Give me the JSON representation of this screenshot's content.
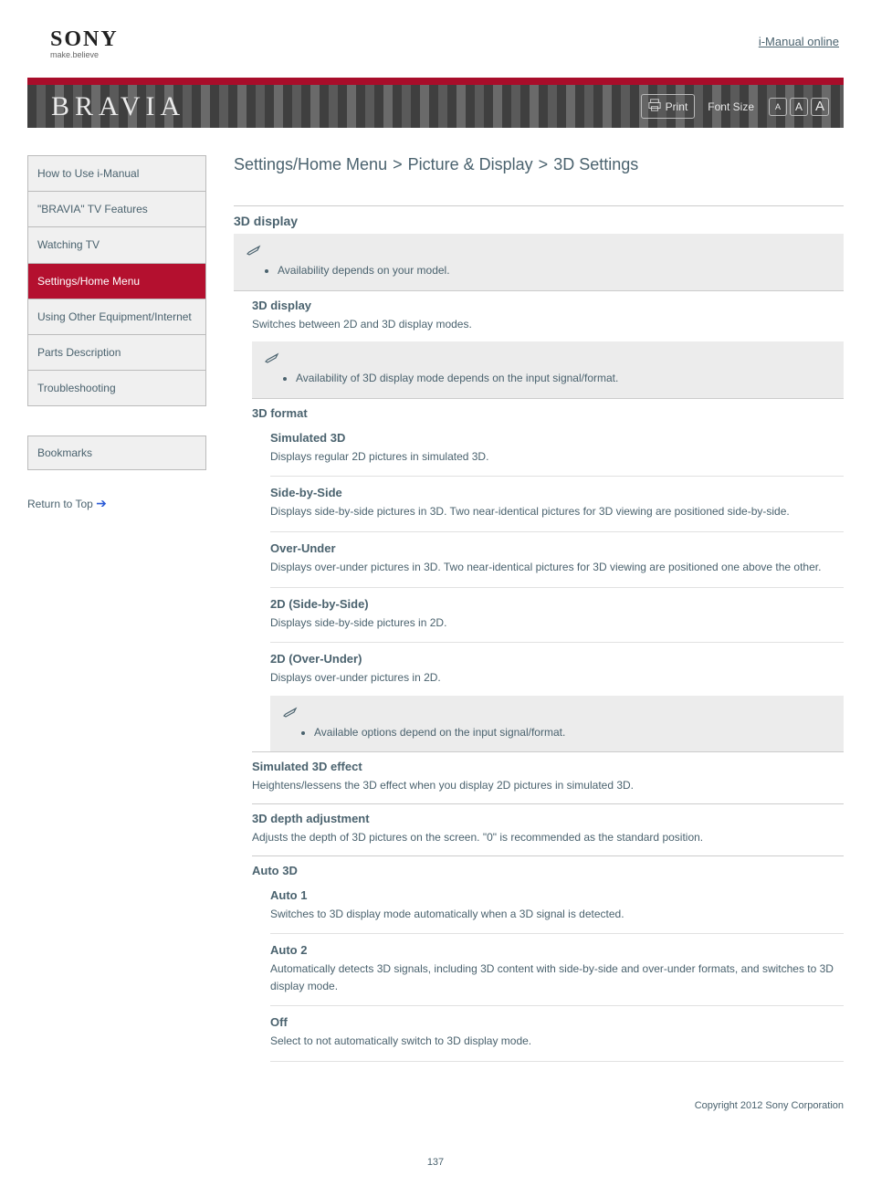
{
  "logo": {
    "brand": "SONY",
    "tagline": "make.believe"
  },
  "header": {
    "manual_link": "i-Manual online"
  },
  "banner": {
    "brand": "BRAVIA",
    "print": "Print",
    "font_size_label": "Font Size",
    "fs_small": "A",
    "fs_med": "A",
    "fs_large": "A"
  },
  "nav": {
    "items": [
      {
        "label": "How to Use i-Manual"
      },
      {
        "label": "\"BRAVIA\" TV Features"
      },
      {
        "label": "Watching TV"
      },
      {
        "label": "Settings/Home Menu"
      },
      {
        "label": "Using Other Equipment/Internet"
      },
      {
        "label": "Parts Description"
      },
      {
        "label": "Troubleshooting"
      }
    ],
    "active_index": 3
  },
  "bookmarks_label": "Bookmarks",
  "trademark": {
    "text": "Return to Top"
  },
  "crumb": {
    "c1": "Settings/Home Menu",
    "c2": "Picture & Display",
    "c3": "3D Settings",
    "sep": ">"
  },
  "section1": {
    "title": "3D display",
    "note": "Availability depends on your model."
  },
  "threeD": {
    "heading": "3D display",
    "desc": "Switches between 2D and 3D display modes.",
    "note": "Availability of 3D display mode depends on the input signal/format."
  },
  "format": {
    "heading": "3D format",
    "items": [
      {
        "title": "Simulated 3D",
        "desc": "Displays regular 2D pictures in simulated 3D."
      },
      {
        "title": "Side-by-Side",
        "desc": "Displays side-by-side pictures in 3D. Two near-identical pictures for 3D viewing are positioned side-by-side."
      },
      {
        "title": "Over-Under",
        "desc": "Displays over-under pictures in 3D. Two near-identical pictures for 3D viewing are positioned one above the other."
      },
      {
        "title": "2D (Side-by-Side)",
        "desc": "Displays side-by-side pictures in 2D."
      },
      {
        "title": "2D (Over-Under)",
        "desc": "Displays over-under pictures in 2D."
      }
    ],
    "note": "Available options depend on the input signal/format."
  },
  "sim3d": {
    "heading": "Simulated 3D effect",
    "desc": "Heightens/lessens the 3D effect when you display 2D pictures in simulated 3D."
  },
  "depth": {
    "heading": "3D depth adjustment",
    "desc": "Adjusts the depth of 3D pictures on the screen. \"0\" is recommended as the standard position."
  },
  "auto3d": {
    "heading": "Auto 3D",
    "items": [
      {
        "title": "Auto 1",
        "desc": "Switches to 3D display mode automatically when a 3D signal is detected."
      },
      {
        "title": "Auto 2",
        "desc": "Automatically detects 3D signals, including 3D content with side-by-side and over-under formats, and switches to 3D display mode."
      },
      {
        "title": "Off",
        "desc": "Select to not automatically switch to 3D display mode."
      }
    ]
  },
  "copyright": "Copyright 2012 Sony Corporation",
  "pagenum": "137"
}
